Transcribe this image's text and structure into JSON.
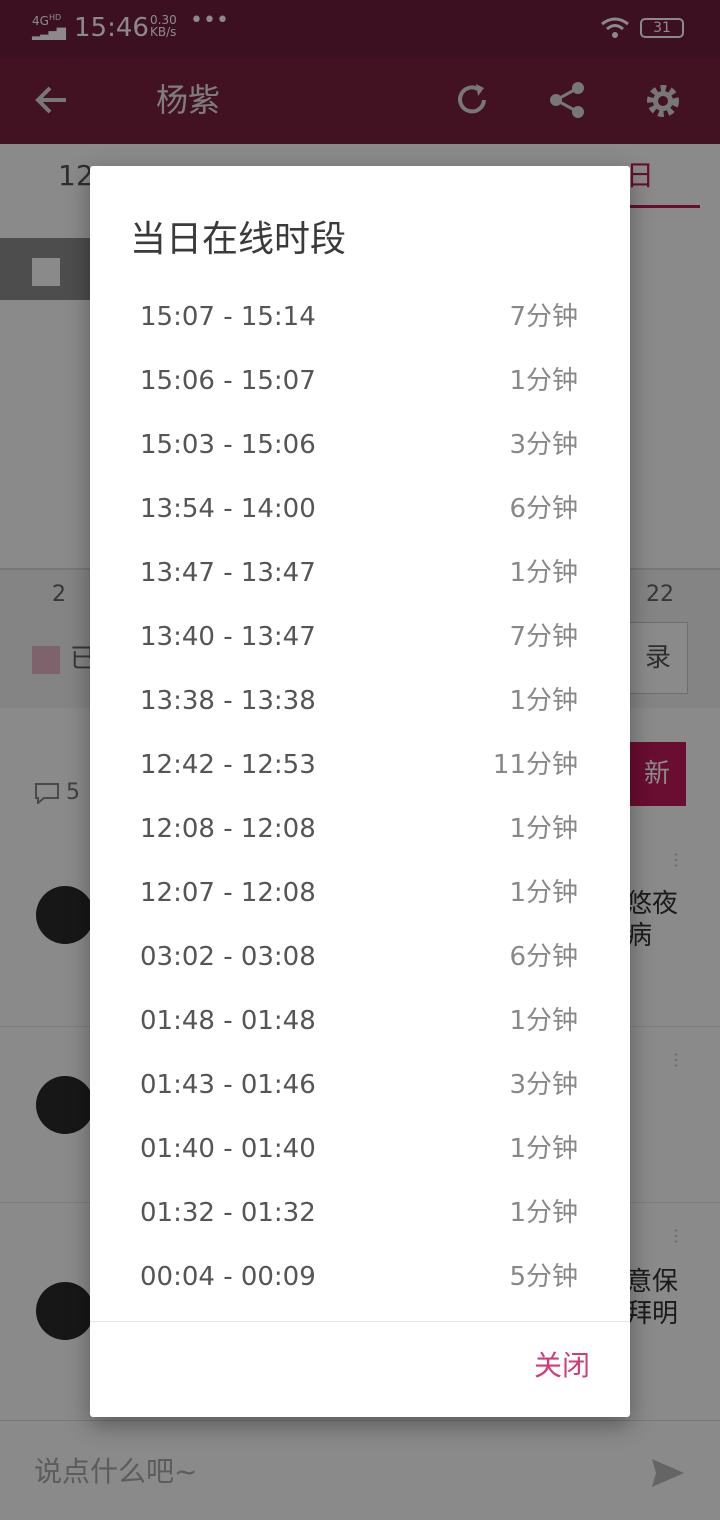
{
  "status_bar": {
    "network": "4G",
    "network_hd": "HD",
    "time": "15:46",
    "speed_value": "0.30",
    "speed_unit": "KB/s",
    "overflow": "•••",
    "battery": "31"
  },
  "app_bar": {
    "title": "杨紫",
    "icons": [
      "back-arrow-icon",
      "refresh-icon",
      "share-icon",
      "gear-icon"
    ]
  },
  "tabs": {
    "left_visible": "12",
    "right_visible": "日"
  },
  "chart": {
    "ticks": [
      "2",
      "22"
    ],
    "legend_label": "已"
  },
  "feed": {
    "comment_count": "5",
    "record_button": "录",
    "update_button": "新",
    "posts": [
      {
        "snippet": "悠夜\n病"
      },
      {
        "snippet": ""
      },
      {
        "snippet": "意保\n拜明"
      }
    ]
  },
  "input": {
    "placeholder": "说点什么吧~"
  },
  "dialog": {
    "title": "当日在线时段",
    "close_label": "关闭",
    "sessions": [
      {
        "range": "15:07 - 15:14",
        "duration": "7分钟"
      },
      {
        "range": "15:06 - 15:07",
        "duration": "1分钟"
      },
      {
        "range": "15:03 - 15:06",
        "duration": "3分钟"
      },
      {
        "range": "13:54 - 14:00",
        "duration": "6分钟"
      },
      {
        "range": "13:47 - 13:47",
        "duration": "1分钟"
      },
      {
        "range": "13:40 - 13:47",
        "duration": "7分钟"
      },
      {
        "range": "13:38 - 13:38",
        "duration": "1分钟"
      },
      {
        "range": "12:42 - 12:53",
        "duration": "11分钟"
      },
      {
        "range": "12:08 - 12:08",
        "duration": "1分钟"
      },
      {
        "range": "12:07 - 12:08",
        "duration": "1分钟"
      },
      {
        "range": "03:02 - 03:08",
        "duration": "6分钟"
      },
      {
        "range": "01:48 - 01:48",
        "duration": "1分钟"
      },
      {
        "range": "01:43 - 01:46",
        "duration": "3分钟"
      },
      {
        "range": "01:40 - 01:40",
        "duration": "1分钟"
      },
      {
        "range": "01:32 - 01:32",
        "duration": "1分钟"
      },
      {
        "range": "00:04 - 00:09",
        "duration": "5分钟"
      }
    ]
  },
  "colors": {
    "app_bar": "#7a2140",
    "accent": "#c2185b",
    "close_text": "#d33b7a"
  }
}
